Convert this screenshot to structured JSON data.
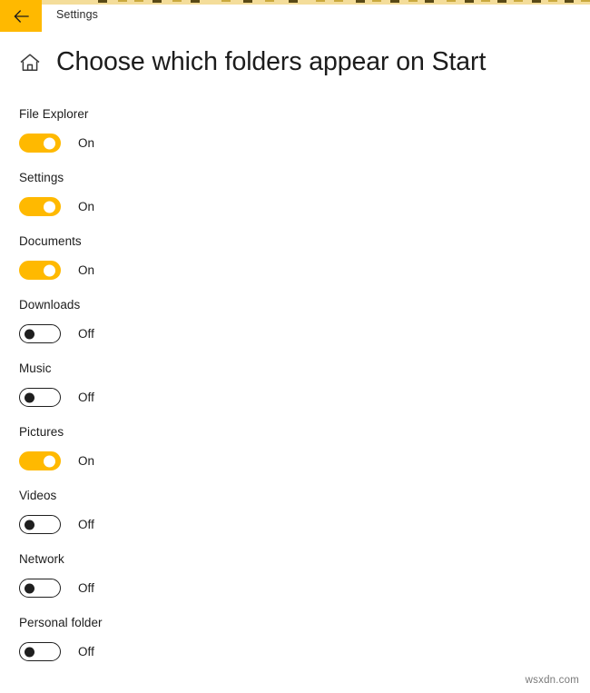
{
  "header": {
    "back_icon": "arrow-left-icon",
    "app_title": "Settings",
    "accent_color": "#ffb900"
  },
  "page": {
    "home_icon": "home-icon",
    "title": "Choose which folders appear on Start"
  },
  "settings": {
    "items": [
      {
        "label": "File Explorer",
        "state": "On",
        "on": true
      },
      {
        "label": "Settings",
        "state": "On",
        "on": true
      },
      {
        "label": "Documents",
        "state": "On",
        "on": true
      },
      {
        "label": "Downloads",
        "state": "Off",
        "on": false
      },
      {
        "label": "Music",
        "state": "Off",
        "on": false
      },
      {
        "label": "Pictures",
        "state": "On",
        "on": true
      },
      {
        "label": "Videos",
        "state": "Off",
        "on": false
      },
      {
        "label": "Network",
        "state": "Off",
        "on": false
      },
      {
        "label": "Personal folder",
        "state": "Off",
        "on": false
      }
    ]
  },
  "watermark": {
    "text": "wsxdn.com"
  }
}
